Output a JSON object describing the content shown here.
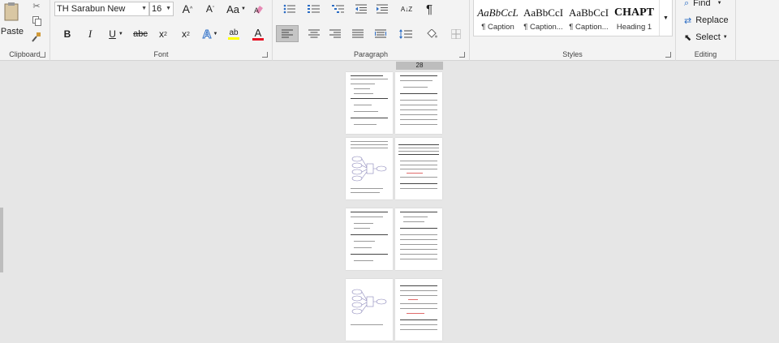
{
  "ribbon": {
    "clipboard": {
      "label": "Clipboard",
      "paste_label": "Paste"
    },
    "font": {
      "label": "Font",
      "font_name": "TH Sarabun New",
      "font_size": "16",
      "grow": "A",
      "shrink": "A",
      "change_case": "Aa",
      "bold": "B",
      "italic": "I",
      "underline": "U",
      "strikethrough": "abc",
      "subscript": "x",
      "subscript_sub": "2",
      "superscript": "x",
      "superscript_sup": "2",
      "text_effects": "A",
      "highlight": "ab",
      "font_color": "A"
    },
    "paragraph": {
      "label": "Paragraph",
      "sort": "A↓Z",
      "pilcrow": "¶"
    },
    "styles": {
      "label": "Styles",
      "items": [
        {
          "preview": "AaBbCcL",
          "name": "¶ Caption"
        },
        {
          "preview": "AaBbCcI",
          "name": "¶ Caption..."
        },
        {
          "preview": "AaBbCcI",
          "name": "¶ Caption..."
        },
        {
          "preview": "CHAPT",
          "name": "Heading 1"
        }
      ]
    },
    "editing": {
      "label": "Editing",
      "find": "Find",
      "replace": "Replace",
      "select": "Select"
    }
  },
  "colors": {
    "font_color_bar": "#e81123",
    "highlight_bar": "#ffff00"
  },
  "document": {
    "page_indicator": "28"
  }
}
